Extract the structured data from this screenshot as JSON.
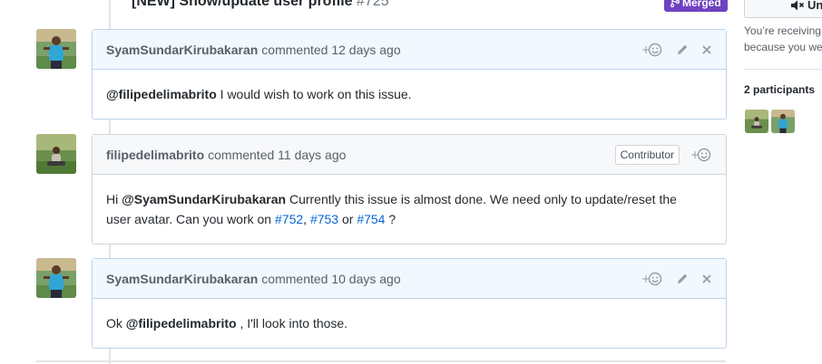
{
  "event": {
    "title": "[NEW] Show/update user profile",
    "number": "#725",
    "badge": "Merged"
  },
  "sidebar": {
    "unsubscribe_label": "Un",
    "receiving_line1": "You’re receiving",
    "receiving_line2": "because you we",
    "participants_title": "2 participants"
  },
  "comments": [
    {
      "author": "SyamSundarKirubakaran",
      "meta": "commented 12 days ago",
      "mention": "@filipedelimabrito",
      "text": " I would wish to work on this issue."
    },
    {
      "author": "filipedelimabrito",
      "meta": "commented 11 days ago",
      "role": "Contributor",
      "prefix": "Hi ",
      "mention": "@SyamSundarKirubakaran",
      "text_line1": " Currently this issue is almost done. We need only to update/reset the",
      "text_line2": "user avatar. Can you work on ",
      "link1": "#752",
      "sep1": ", ",
      "link2": "#753",
      "sep2": " or ",
      "link3": "#754",
      "suffix": " ?"
    },
    {
      "author": "SyamSundarKirubakaran",
      "meta": "commented 10 days ago",
      "prefix": "Ok ",
      "mention": "@filipedelimabrito",
      "text": " , I'll look into those."
    }
  ],
  "icons": {
    "reaction": "add-reaction-icon",
    "edit": "pencil-icon",
    "delete": "close-icon",
    "mute": "mute-icon",
    "merge": "git-merge-icon"
  },
  "colors": {
    "merged": "#6f42c1",
    "link": "#0366d6",
    "owner_header": "#f1f8ff"
  }
}
